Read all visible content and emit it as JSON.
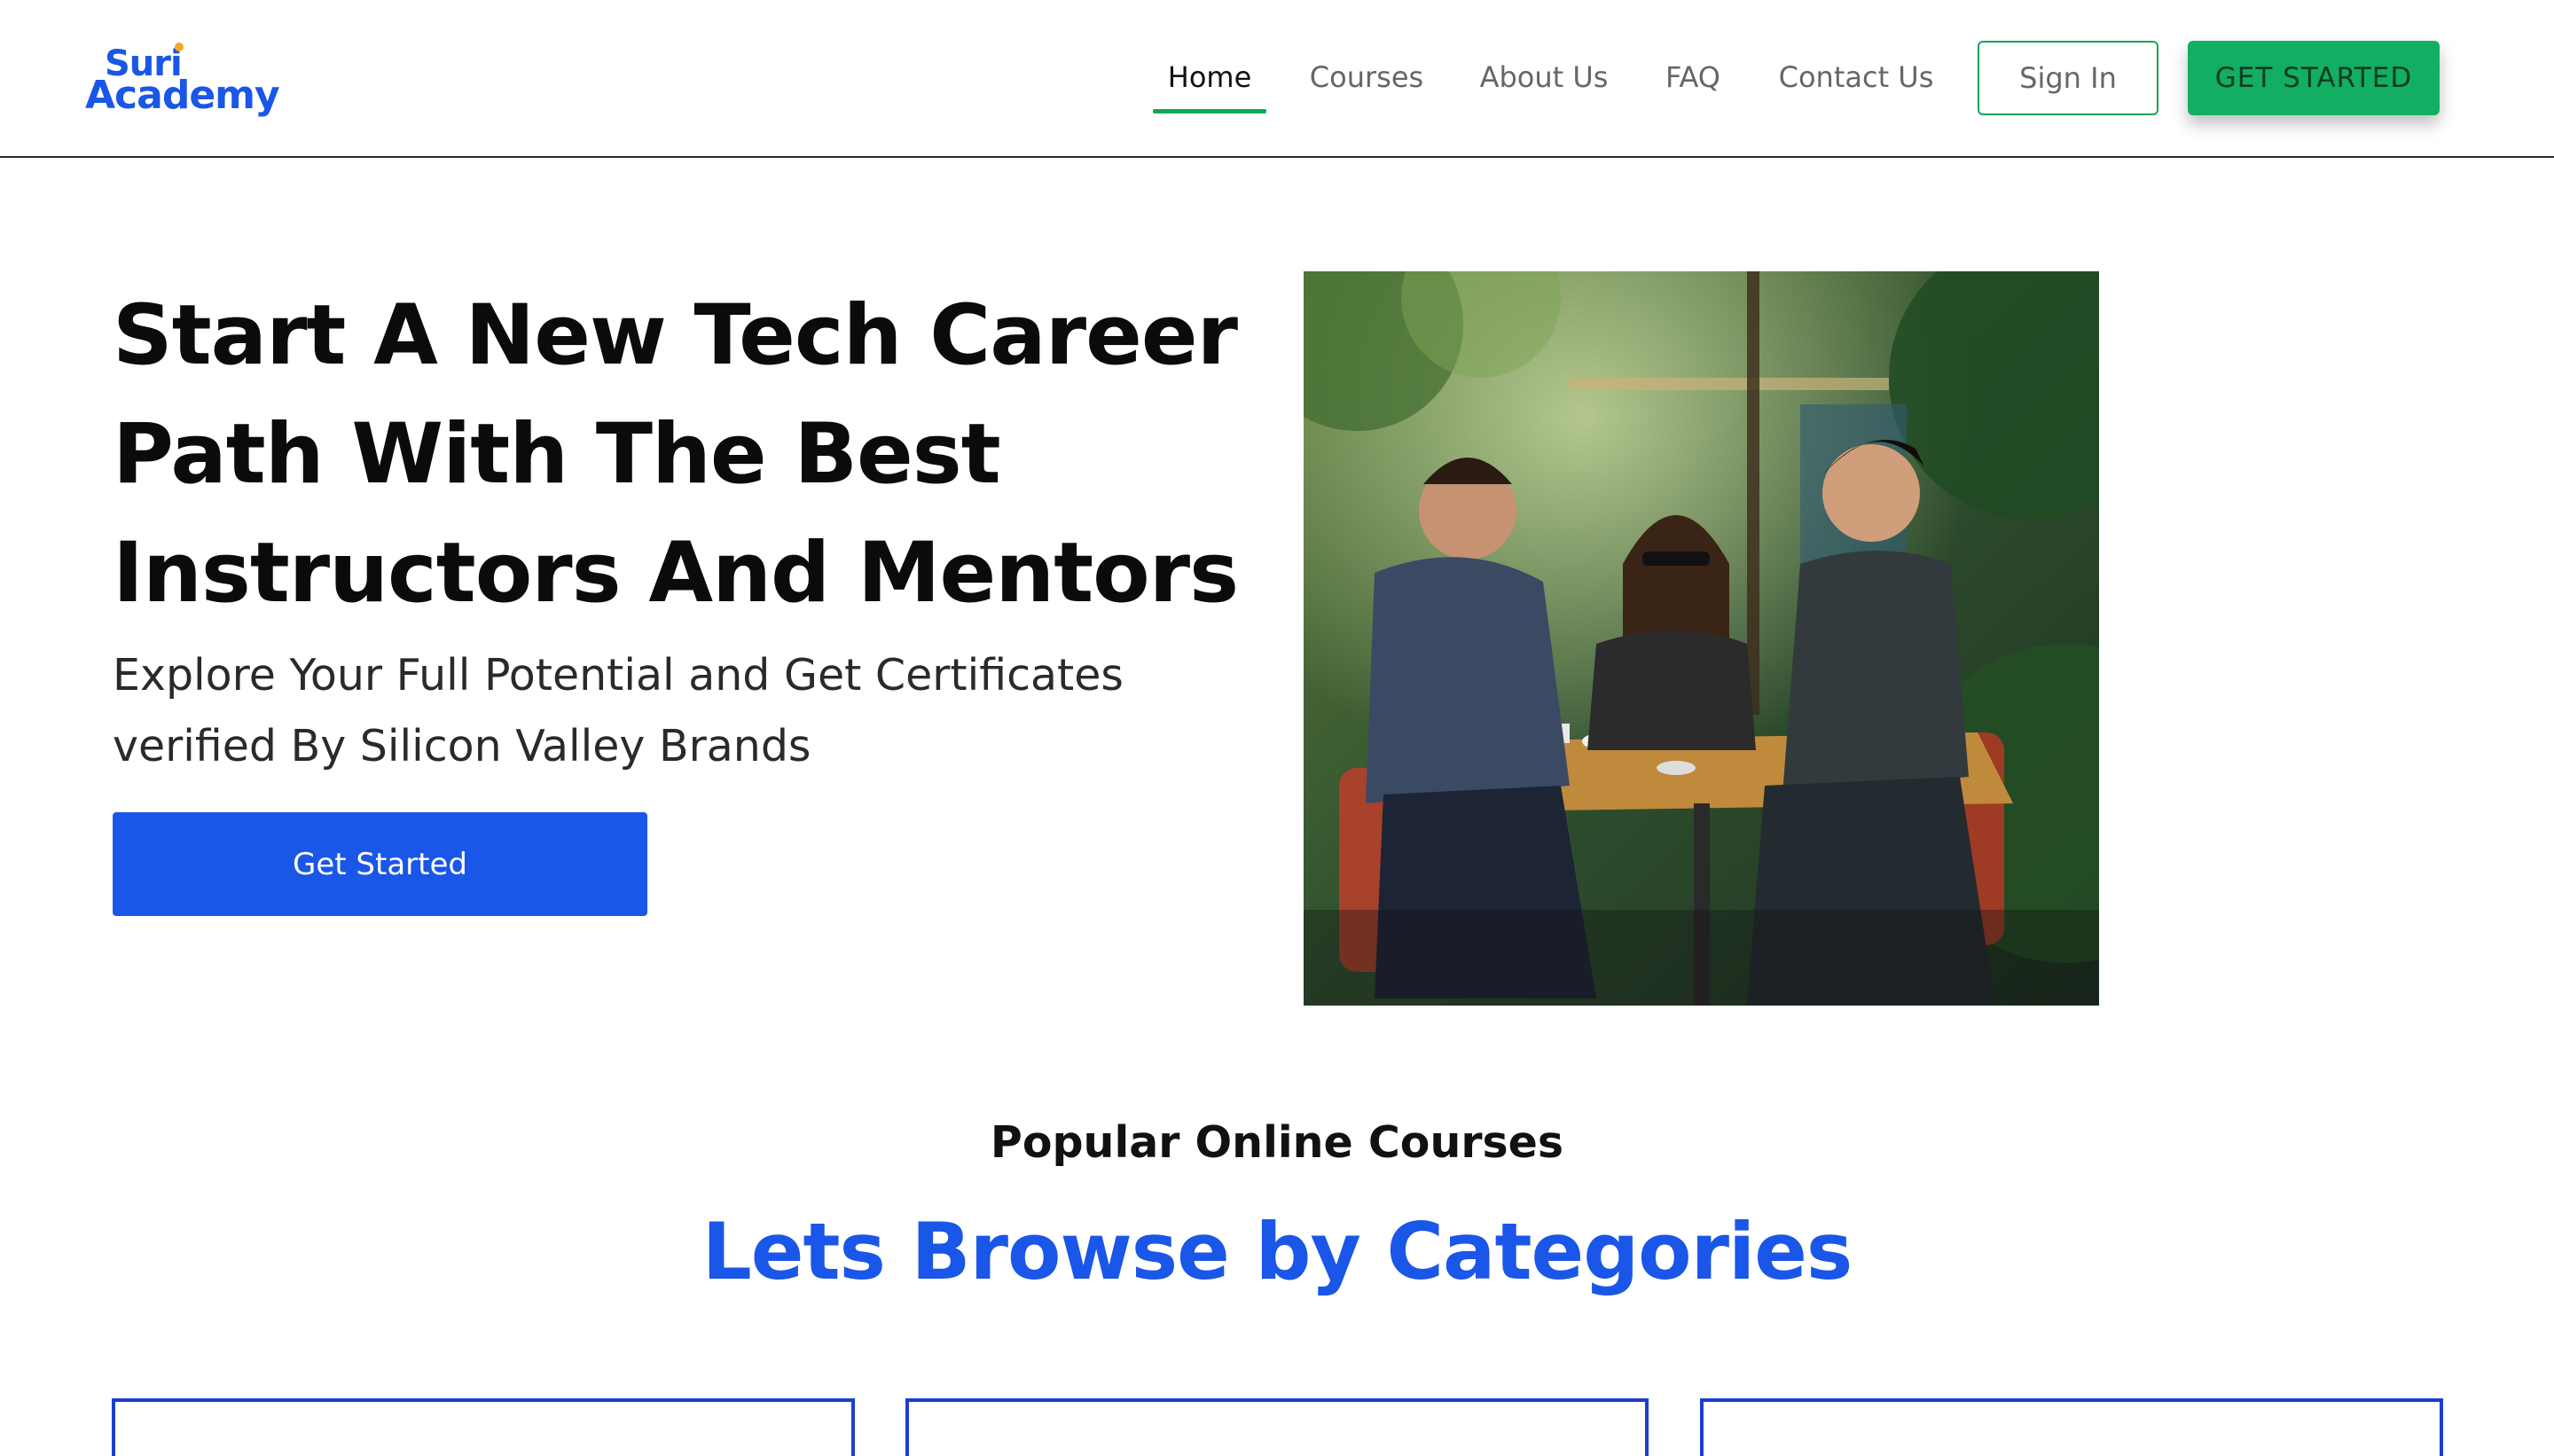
{
  "brand": {
    "logo_line1": "Suri",
    "logo_line2": "Academy",
    "accent": "#1a56e8",
    "green": "#12ae62"
  },
  "nav": {
    "items": [
      {
        "label": "Home",
        "active": true
      },
      {
        "label": "Courses",
        "active": false
      },
      {
        "label": "About Us",
        "active": false
      },
      {
        "label": "FAQ",
        "active": false
      },
      {
        "label": "Contact Us",
        "active": false
      }
    ],
    "sign_in": "Sign In",
    "get_started": "GET STARTED"
  },
  "hero": {
    "title_lines": [
      "Start A New Tech Career",
      "Path With The Best",
      "Instructors And Mentors"
    ],
    "subtitle_lines": [
      "Explore Your Full Potential and Get Certificates",
      "verified By Silicon Valley Brands"
    ],
    "cta": "Get Started",
    "image": "students-at-cafe-table-photo"
  },
  "categories": {
    "kicker": "Popular Online Courses",
    "title": "Lets Browse by Categories",
    "cards": [
      {},
      {},
      {}
    ]
  }
}
